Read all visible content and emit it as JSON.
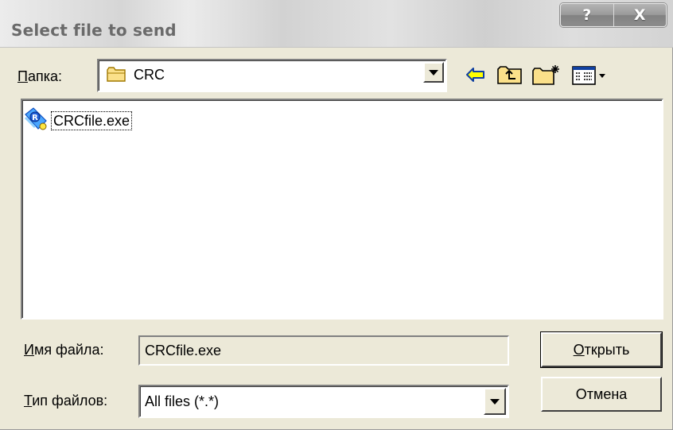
{
  "window": {
    "title": "Select file to send",
    "help_label": "?",
    "close_label": "X"
  },
  "folder": {
    "label_access_key": "П",
    "label_rest": "апка:",
    "current": "CRC"
  },
  "toolbar": {
    "buttons": [
      "back-icon",
      "up-folder-icon",
      "new-folder-icon",
      "view-menu-icon"
    ]
  },
  "files": [
    {
      "name": "CRCfile.exe",
      "icon": "executable-icon"
    }
  ],
  "filename": {
    "label_access_key": "И",
    "label_rest": "мя файла:",
    "value": "CRCfile.exe"
  },
  "filetype": {
    "label_access_key": "Т",
    "label_rest": "ип файлов:",
    "value": "All files (*.*)"
  },
  "buttons": {
    "open_access_key": "О",
    "open_rest": "ткрыть",
    "cancel": "Отмена"
  },
  "colors": {
    "dialog_bg": "#ece9d8",
    "titlebar_text": "#6a6a6a",
    "arrow_yellow": "#ffff00"
  }
}
